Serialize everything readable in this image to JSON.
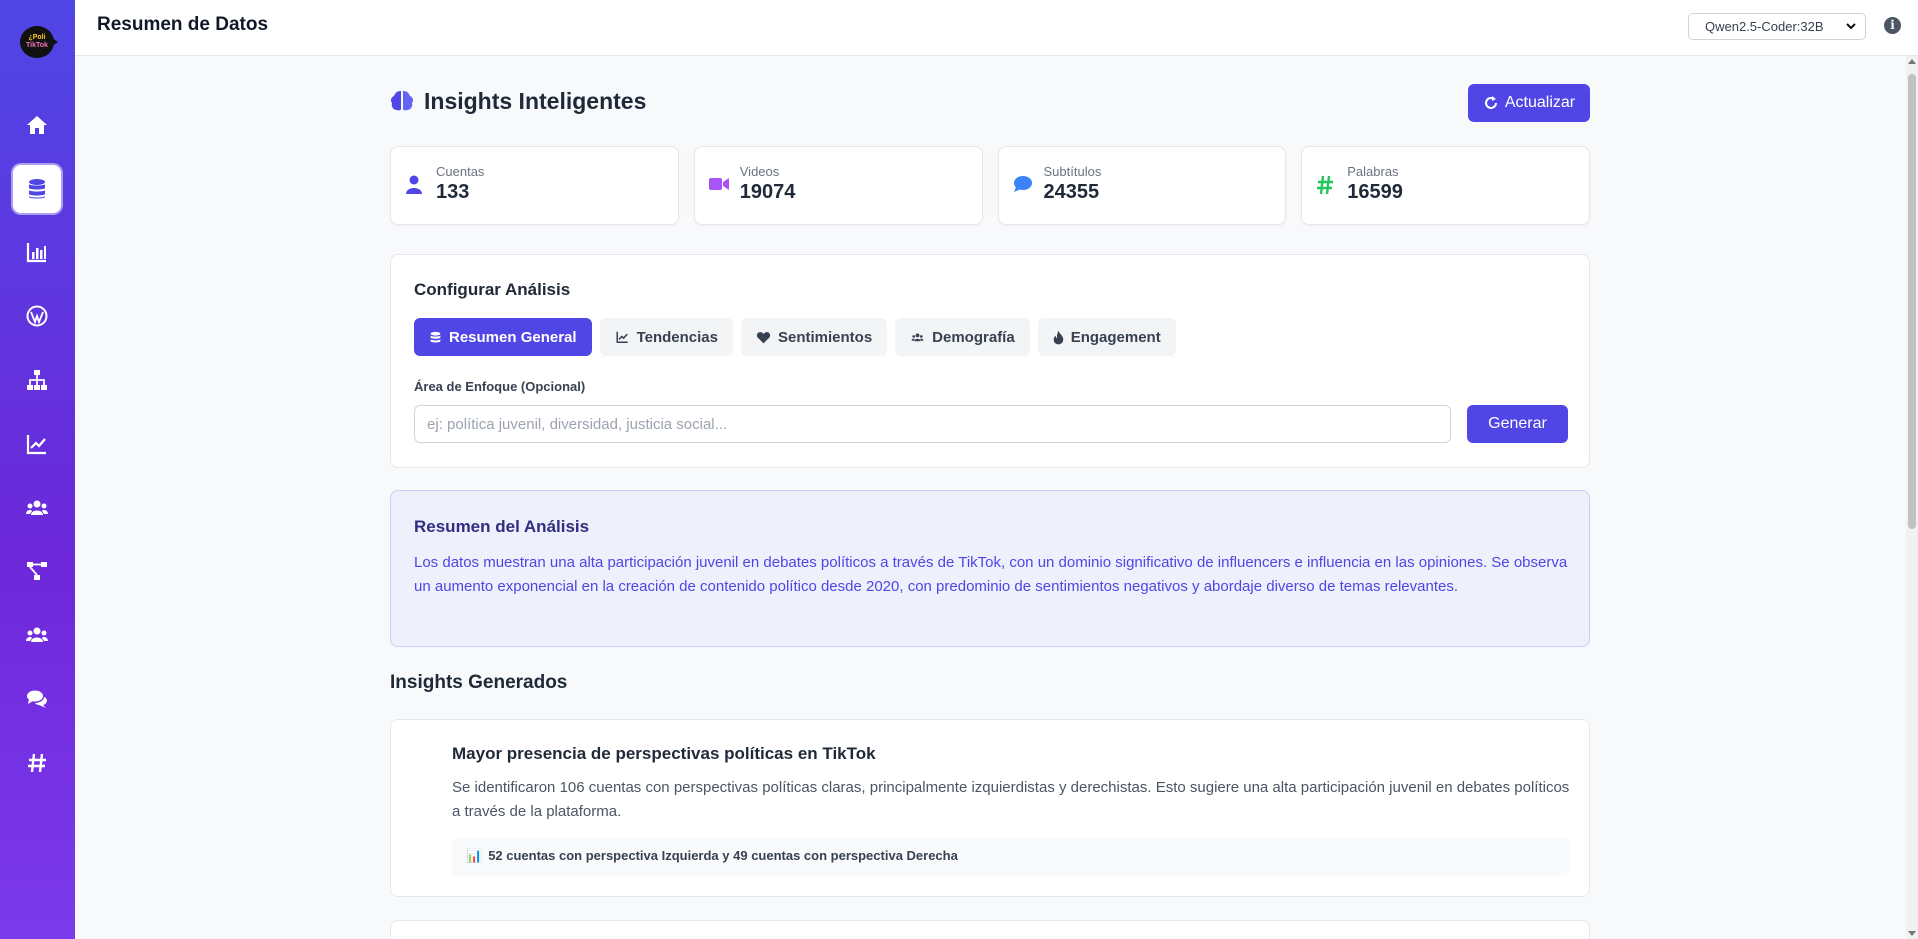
{
  "logo": {
    "line1": "¿Poli",
    "line2": "TikTok"
  },
  "sidebar": {
    "items": [
      {
        "name": "home",
        "icon": "home-icon"
      },
      {
        "name": "database",
        "icon": "database-icon",
        "active": true
      },
      {
        "name": "bar-chart",
        "icon": "bar-chart-icon"
      },
      {
        "name": "wordpress",
        "icon": "wordpress-icon"
      },
      {
        "name": "network",
        "icon": "sitemap-icon"
      },
      {
        "name": "trends",
        "icon": "line-chart-icon"
      },
      {
        "name": "users",
        "icon": "users-icon"
      },
      {
        "name": "project",
        "icon": "project-diagram-icon"
      },
      {
        "name": "communities",
        "icon": "users-icon"
      },
      {
        "name": "comments",
        "icon": "comments-icon"
      },
      {
        "name": "hashtags",
        "icon": "hashtag-icon"
      }
    ]
  },
  "topbar": {
    "title": "Resumen de Datos",
    "model": "Qwen2.5-Coder:32B",
    "info_glyph": "i"
  },
  "header": {
    "title": "Insights Inteligentes",
    "refresh_label": "Actualizar"
  },
  "stats": [
    {
      "label": "Cuentas",
      "value": "133",
      "icon": "user-icon",
      "color": "#4f46e5"
    },
    {
      "label": "Videos",
      "value": "19074",
      "icon": "video-icon",
      "color": "#a855f7"
    },
    {
      "label": "Subtítulos",
      "value": "24355",
      "icon": "comment-icon",
      "color": "#3b82f6"
    },
    {
      "label": "Palabras",
      "value": "16599",
      "icon": "hashtag-icon",
      "color": "#22c55e"
    }
  ],
  "config": {
    "title": "Configurar Análisis",
    "tabs": [
      {
        "label": "Resumen General",
        "icon": "database-icon",
        "active": true
      },
      {
        "label": "Tendencias",
        "icon": "line-chart-icon"
      },
      {
        "label": "Sentimientos",
        "icon": "heart-icon"
      },
      {
        "label": "Demografía",
        "icon": "users-icon"
      },
      {
        "label": "Engagement",
        "icon": "fire-icon"
      }
    ],
    "focus_label": "Área de Enfoque (Opcional)",
    "focus_placeholder": "ej: política juvenil, diversidad, justicia social...",
    "focus_value": "",
    "generate_label": "Generar"
  },
  "summary": {
    "title": "Resumen del Análisis",
    "text": "Los datos muestran una alta participación juvenil en debates políticos a través de TikTok, con un dominio significativo de influencers e influencia en las opiniones. Se observa un aumento exponencial en la creación de contenido político desde 2020, con predominio de sentimientos negativos y abordaje diverso de temas relevantes."
  },
  "insights": {
    "title": "Insights Generados",
    "items": [
      {
        "heading": "Mayor presencia de perspectivas políticas en TikTok",
        "text": "Se identificaron 106 cuentas con perspectivas políticas claras, principalmente izquierdistas y derechistas. Esto sugiere una alta participación juvenil en debates políticos a través de la plataforma.",
        "metric_icon": "📊",
        "metric": "52 cuentas con perspectiva Izquierda y 49 cuentas con perspectiva Derecha"
      }
    ]
  },
  "colors": {
    "accent": "#4f46e5",
    "sidebar_start": "#4f46e5",
    "sidebar_end": "#7c3aed"
  }
}
